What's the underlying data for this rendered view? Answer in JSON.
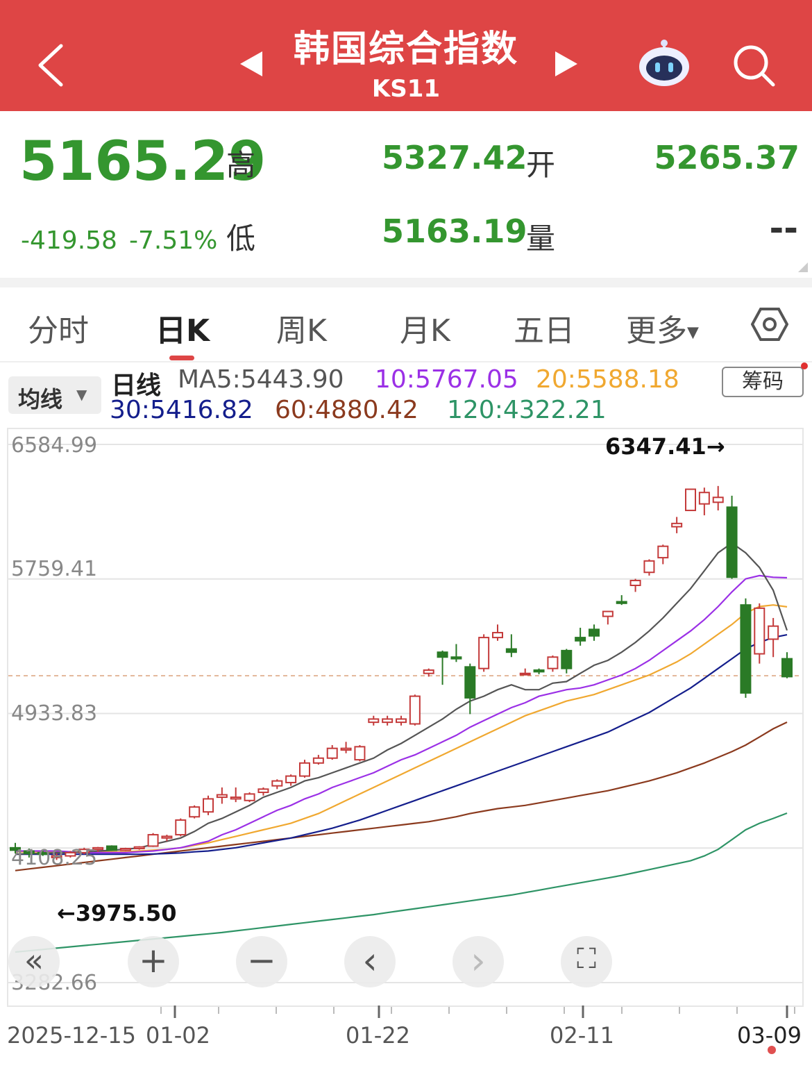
{
  "header": {
    "title": "韩国综合指数",
    "code": "KS11",
    "bg_color": "#de4545",
    "icons": [
      "back-icon",
      "prev-icon",
      "next-icon",
      "robot-icon",
      "search-icon"
    ]
  },
  "quote": {
    "price": "5165.29",
    "change": "-419.58",
    "change_pct": "-7.51%",
    "high_label": "高",
    "high": "5327.42",
    "low_label": "低",
    "low": "5163.19",
    "open_label": "开",
    "open": "5265.37",
    "volume_label": "量",
    "volume": "--",
    "color": "#34962f"
  },
  "tabs": [
    {
      "label": "分时",
      "active": false
    },
    {
      "label": "日K",
      "active": true
    },
    {
      "label": "周K",
      "active": false
    },
    {
      "label": "月K",
      "active": false
    },
    {
      "label": "五日",
      "active": false
    },
    {
      "label": "更多",
      "active": false
    }
  ],
  "indicator": {
    "selector_label": "均线",
    "line_type": "日线",
    "ma5": "MA5:5443.90",
    "ma10": "10:5767.05",
    "ma20": "20:5588.18",
    "ma30": "30:5416.82",
    "ma60": "60:4880.42",
    "ma120": "120:4322.21",
    "chip_button": "筹码",
    "colors": {
      "ma5": "#555555",
      "ma10": "#9b30e6",
      "ma20": "#f0a830",
      "ma30": "#141e8c",
      "ma60": "#8b3a1e",
      "ma120": "#2e9466",
      "up": "#c43a3a",
      "down": "#2a7a26"
    }
  },
  "chart_data": {
    "type": "candlestick",
    "ylim": [
      3282.66,
      6584.99
    ],
    "y_ticks": [
      "6584.99",
      "5759.41",
      "4933.83",
      "4108.25",
      "3282.66"
    ],
    "x_tick_labels": [
      "2025-12-15",
      "01-02",
      "01-22",
      "02-11",
      "03-09"
    ],
    "max_annotation": "6347.41→",
    "min_annotation": "←3975.50",
    "last_price": 5165.29,
    "candles": [
      [
        4110,
        4140,
        4075,
        4095
      ],
      [
        4090,
        4105,
        4050,
        4075
      ],
      [
        4080,
        4100,
        4060,
        4070
      ],
      [
        4050,
        4075,
        4035,
        4060
      ],
      [
        4060,
        4090,
        4050,
        4080
      ],
      [
        4080,
        4110,
        4070,
        4100
      ],
      [
        4100,
        4115,
        4085,
        4110
      ],
      [
        4120,
        4125,
        4090,
        4095
      ],
      [
        4095,
        4110,
        4090,
        4105
      ],
      [
        4105,
        4120,
        4098,
        4115
      ],
      [
        4120,
        4200,
        4115,
        4190
      ],
      [
        4170,
        4190,
        4150,
        4180
      ],
      [
        4190,
        4290,
        4180,
        4280
      ],
      [
        4300,
        4370,
        4290,
        4360
      ],
      [
        4330,
        4430,
        4310,
        4410
      ],
      [
        4420,
        4480,
        4380,
        4435
      ],
      [
        4410,
        4480,
        4390,
        4420
      ],
      [
        4400,
        4450,
        4390,
        4440
      ],
      [
        4450,
        4480,
        4430,
        4470
      ],
      [
        4490,
        4530,
        4470,
        4520
      ],
      [
        4510,
        4560,
        4490,
        4550
      ],
      [
        4550,
        4650,
        4540,
        4630
      ],
      [
        4630,
        4680,
        4620,
        4660
      ],
      [
        4660,
        4740,
        4650,
        4720
      ],
      [
        4710,
        4760,
        4690,
        4720
      ],
      [
        4650,
        4740,
        4640,
        4730
      ],
      [
        4880,
        4920,
        4860,
        4900
      ],
      [
        4880,
        4920,
        4860,
        4900
      ],
      [
        4880,
        4920,
        4860,
        4900
      ],
      [
        4870,
        5050,
        4860,
        5040
      ],
      [
        5180,
        5210,
        5160,
        5200
      ],
      [
        5310,
        5320,
        5110,
        5280
      ],
      [
        5280,
        5360,
        5250,
        5270
      ],
      [
        5220,
        5240,
        4930,
        5030
      ],
      [
        5210,
        5420,
        5190,
        5400
      ],
      [
        5400,
        5480,
        5380,
        5430
      ],
      [
        5330,
        5420,
        5280,
        5310
      ],
      [
        5180,
        5210,
        5170,
        5180
      ],
      [
        5200,
        5210,
        5175,
        5190
      ],
      [
        5210,
        5290,
        5190,
        5280
      ],
      [
        5320,
        5330,
        5180,
        5210
      ],
      [
        5400,
        5460,
        5350,
        5380
      ],
      [
        5450,
        5480,
        5380,
        5410
      ],
      [
        5530,
        5560,
        5480,
        5560
      ],
      [
        5620,
        5660,
        5600,
        5610
      ],
      [
        5720,
        5760,
        5680,
        5750
      ],
      [
        5800,
        5880,
        5780,
        5870
      ],
      [
        5890,
        5970,
        5850,
        5960
      ],
      [
        6080,
        6140,
        6040,
        6100
      ],
      [
        6180,
        6310,
        6180,
        6310
      ],
      [
        6220,
        6320,
        6150,
        6290
      ],
      [
        6230,
        6330,
        6180,
        6260
      ],
      [
        6200,
        6270,
        5760,
        5770
      ],
      [
        5600,
        5640,
        5030,
        5060
      ],
      [
        5300,
        5610,
        5240,
        5580
      ],
      [
        5390,
        5520,
        5280,
        5470
      ],
      [
        5270,
        5310,
        5150,
        5160
      ]
    ],
    "ma5": [
      4070,
      4075,
      4075,
      4080,
      4080,
      4085,
      4090,
      4095,
      4100,
      4110,
      4130,
      4150,
      4170,
      4210,
      4260,
      4290,
      4330,
      4370,
      4420,
      4450,
      4480,
      4520,
      4540,
      4570,
      4600,
      4630,
      4660,
      4710,
      4750,
      4800,
      4850,
      4900,
      4960,
      5010,
      5040,
      5080,
      5110,
      5080,
      5080,
      5120,
      5130,
      5180,
      5230,
      5260,
      5310,
      5370,
      5440,
      5520,
      5610,
      5700,
      5810,
      5920,
      5980,
      5920,
      5830,
      5690,
      5443.9
    ],
    "ma10": [
      4090,
      4090,
      4090,
      4090,
      4085,
      4080,
      4080,
      4080,
      4080,
      4085,
      4090,
      4100,
      4110,
      4130,
      4150,
      4190,
      4220,
      4260,
      4300,
      4340,
      4370,
      4410,
      4440,
      4480,
      4510,
      4540,
      4570,
      4610,
      4650,
      4680,
      4720,
      4760,
      4800,
      4850,
      4890,
      4930,
      4970,
      5000,
      5040,
      5060,
      5080,
      5090,
      5110,
      5140,
      5170,
      5210,
      5260,
      5320,
      5380,
      5440,
      5510,
      5590,
      5680,
      5760,
      5780,
      5770,
      5767.05
    ],
    "ma20": [
      4085,
      4085,
      4085,
      4085,
      4085,
      4085,
      4085,
      4085,
      4085,
      4090,
      4095,
      4100,
      4110,
      4125,
      4140,
      4160,
      4180,
      4200,
      4220,
      4240,
      4260,
      4290,
      4320,
      4360,
      4400,
      4440,
      4480,
      4520,
      4560,
      4600,
      4640,
      4680,
      4720,
      4760,
      4800,
      4840,
      4880,
      4920,
      4950,
      4980,
      5010,
      5030,
      5050,
      5080,
      5110,
      5140,
      5170,
      5210,
      5250,
      5300,
      5360,
      5420,
      5480,
      5550,
      5590,
      5600,
      5588.18
    ],
    "ma30": [
      4070,
      4070,
      4070,
      4070,
      4070,
      4070,
      4070,
      4070,
      4070,
      4070,
      4072,
      4075,
      4078,
      4085,
      4090,
      4100,
      4110,
      4125,
      4140,
      4155,
      4170,
      4190,
      4210,
      4230,
      4255,
      4280,
      4310,
      4340,
      4370,
      4400,
      4430,
      4460,
      4490,
      4520,
      4550,
      4580,
      4610,
      4640,
      4670,
      4700,
      4730,
      4760,
      4790,
      4820,
      4860,
      4900,
      4940,
      4990,
      5040,
      5090,
      5150,
      5210,
      5270,
      5330,
      5370,
      5400,
      5416.82
    ],
    "ma60": [
      3970,
      3980,
      3990,
      4000,
      4010,
      4020,
      4030,
      4040,
      4050,
      4060,
      4070,
      4080,
      4090,
      4100,
      4110,
      4120,
      4130,
      4140,
      4150,
      4160,
      4170,
      4180,
      4190,
      4200,
      4210,
      4220,
      4230,
      4240,
      4250,
      4260,
      4270,
      4285,
      4300,
      4320,
      4335,
      4350,
      4360,
      4370,
      4385,
      4400,
      4415,
      4430,
      4445,
      4460,
      4480,
      4500,
      4520,
      4545,
      4570,
      4600,
      4630,
      4665,
      4700,
      4740,
      4790,
      4840,
      4880.42
    ],
    "ma120": [
      3470,
      3478,
      3486,
      3494,
      3502,
      3510,
      3518,
      3526,
      3534,
      3542,
      3550,
      3558,
      3566,
      3574,
      3582,
      3590,
      3600,
      3610,
      3620,
      3630,
      3640,
      3650,
      3660,
      3670,
      3680,
      3690,
      3700,
      3712,
      3724,
      3736,
      3748,
      3760,
      3772,
      3784,
      3796,
      3808,
      3820,
      3835,
      3850,
      3865,
      3880,
      3895,
      3910,
      3925,
      3940,
      3958,
      3976,
      3994,
      4012,
      4030,
      4060,
      4100,
      4160,
      4220,
      4260,
      4290,
      4322.21
    ]
  },
  "controls": [
    {
      "name": "scroll-left",
      "glyph": "«"
    },
    {
      "name": "zoom-in",
      "glyph": "+"
    },
    {
      "name": "zoom-out",
      "glyph": "−"
    },
    {
      "name": "prev",
      "glyph": "‹"
    },
    {
      "name": "next",
      "glyph": "›"
    },
    {
      "name": "fullscreen",
      "glyph": "⛶"
    }
  ]
}
